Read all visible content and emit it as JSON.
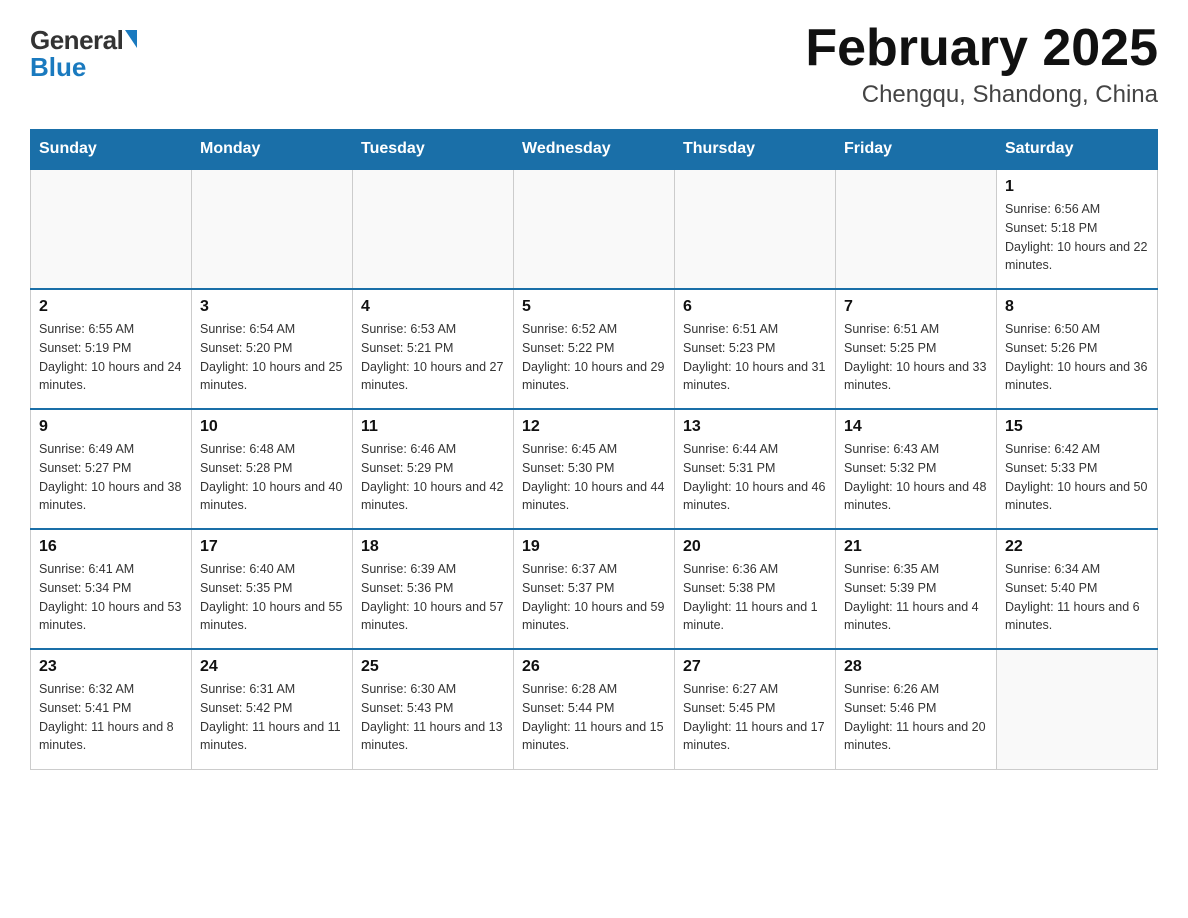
{
  "header": {
    "logo_general": "General",
    "logo_blue": "Blue",
    "month_title": "February 2025",
    "location": "Chengqu, Shandong, China"
  },
  "days_of_week": [
    "Sunday",
    "Monday",
    "Tuesday",
    "Wednesday",
    "Thursday",
    "Friday",
    "Saturday"
  ],
  "weeks": [
    [
      {
        "day": "",
        "info": ""
      },
      {
        "day": "",
        "info": ""
      },
      {
        "day": "",
        "info": ""
      },
      {
        "day": "",
        "info": ""
      },
      {
        "day": "",
        "info": ""
      },
      {
        "day": "",
        "info": ""
      },
      {
        "day": "1",
        "info": "Sunrise: 6:56 AM\nSunset: 5:18 PM\nDaylight: 10 hours and 22 minutes."
      }
    ],
    [
      {
        "day": "2",
        "info": "Sunrise: 6:55 AM\nSunset: 5:19 PM\nDaylight: 10 hours and 24 minutes."
      },
      {
        "day": "3",
        "info": "Sunrise: 6:54 AM\nSunset: 5:20 PM\nDaylight: 10 hours and 25 minutes."
      },
      {
        "day": "4",
        "info": "Sunrise: 6:53 AM\nSunset: 5:21 PM\nDaylight: 10 hours and 27 minutes."
      },
      {
        "day": "5",
        "info": "Sunrise: 6:52 AM\nSunset: 5:22 PM\nDaylight: 10 hours and 29 minutes."
      },
      {
        "day": "6",
        "info": "Sunrise: 6:51 AM\nSunset: 5:23 PM\nDaylight: 10 hours and 31 minutes."
      },
      {
        "day": "7",
        "info": "Sunrise: 6:51 AM\nSunset: 5:25 PM\nDaylight: 10 hours and 33 minutes."
      },
      {
        "day": "8",
        "info": "Sunrise: 6:50 AM\nSunset: 5:26 PM\nDaylight: 10 hours and 36 minutes."
      }
    ],
    [
      {
        "day": "9",
        "info": "Sunrise: 6:49 AM\nSunset: 5:27 PM\nDaylight: 10 hours and 38 minutes."
      },
      {
        "day": "10",
        "info": "Sunrise: 6:48 AM\nSunset: 5:28 PM\nDaylight: 10 hours and 40 minutes."
      },
      {
        "day": "11",
        "info": "Sunrise: 6:46 AM\nSunset: 5:29 PM\nDaylight: 10 hours and 42 minutes."
      },
      {
        "day": "12",
        "info": "Sunrise: 6:45 AM\nSunset: 5:30 PM\nDaylight: 10 hours and 44 minutes."
      },
      {
        "day": "13",
        "info": "Sunrise: 6:44 AM\nSunset: 5:31 PM\nDaylight: 10 hours and 46 minutes."
      },
      {
        "day": "14",
        "info": "Sunrise: 6:43 AM\nSunset: 5:32 PM\nDaylight: 10 hours and 48 minutes."
      },
      {
        "day": "15",
        "info": "Sunrise: 6:42 AM\nSunset: 5:33 PM\nDaylight: 10 hours and 50 minutes."
      }
    ],
    [
      {
        "day": "16",
        "info": "Sunrise: 6:41 AM\nSunset: 5:34 PM\nDaylight: 10 hours and 53 minutes."
      },
      {
        "day": "17",
        "info": "Sunrise: 6:40 AM\nSunset: 5:35 PM\nDaylight: 10 hours and 55 minutes."
      },
      {
        "day": "18",
        "info": "Sunrise: 6:39 AM\nSunset: 5:36 PM\nDaylight: 10 hours and 57 minutes."
      },
      {
        "day": "19",
        "info": "Sunrise: 6:37 AM\nSunset: 5:37 PM\nDaylight: 10 hours and 59 minutes."
      },
      {
        "day": "20",
        "info": "Sunrise: 6:36 AM\nSunset: 5:38 PM\nDaylight: 11 hours and 1 minute."
      },
      {
        "day": "21",
        "info": "Sunrise: 6:35 AM\nSunset: 5:39 PM\nDaylight: 11 hours and 4 minutes."
      },
      {
        "day": "22",
        "info": "Sunrise: 6:34 AM\nSunset: 5:40 PM\nDaylight: 11 hours and 6 minutes."
      }
    ],
    [
      {
        "day": "23",
        "info": "Sunrise: 6:32 AM\nSunset: 5:41 PM\nDaylight: 11 hours and 8 minutes."
      },
      {
        "day": "24",
        "info": "Sunrise: 6:31 AM\nSunset: 5:42 PM\nDaylight: 11 hours and 11 minutes."
      },
      {
        "day": "25",
        "info": "Sunrise: 6:30 AM\nSunset: 5:43 PM\nDaylight: 11 hours and 13 minutes."
      },
      {
        "day": "26",
        "info": "Sunrise: 6:28 AM\nSunset: 5:44 PM\nDaylight: 11 hours and 15 minutes."
      },
      {
        "day": "27",
        "info": "Sunrise: 6:27 AM\nSunset: 5:45 PM\nDaylight: 11 hours and 17 minutes."
      },
      {
        "day": "28",
        "info": "Sunrise: 6:26 AM\nSunset: 5:46 PM\nDaylight: 11 hours and 20 minutes."
      },
      {
        "day": "",
        "info": ""
      }
    ]
  ]
}
